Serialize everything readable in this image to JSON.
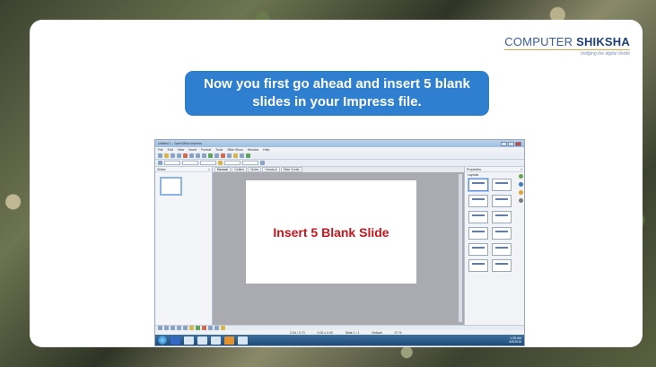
{
  "logo": {
    "title_part1": "COMPUTER",
    "title_part2": "SHIKSHA",
    "tagline": "bridging the digital divide"
  },
  "banner": {
    "text": "Now you first go ahead and insert 5 blank slides in your Impress file."
  },
  "screenshot": {
    "window_title": "Untitled 1 - OpenOffice Impress",
    "menu": [
      "File",
      "Edit",
      "View",
      "Insert",
      "Format",
      "Tools",
      "Slide Show",
      "Window",
      "Help"
    ],
    "slides_pane_title": "Slides",
    "view_tabs": [
      "Normal",
      "Outline",
      "Notes",
      "Handout",
      "Slide Sorter"
    ],
    "slide_text": "Insert 5 Blank Slide",
    "properties_title": "Properties",
    "layouts_label": "Layouts",
    "status": {
      "position": "2.04 / 3.73",
      "size": "0.00 x 0.00",
      "slide": "Slide 1 / 1",
      "layout": "Default",
      "zoom": "37 %"
    },
    "clock": {
      "time": "1:26 AM",
      "date": "6/9/2016"
    }
  },
  "colors": {
    "banner": "#2f7fd0",
    "slide_text": "#c8161d",
    "logo": "#3a5d9c"
  }
}
